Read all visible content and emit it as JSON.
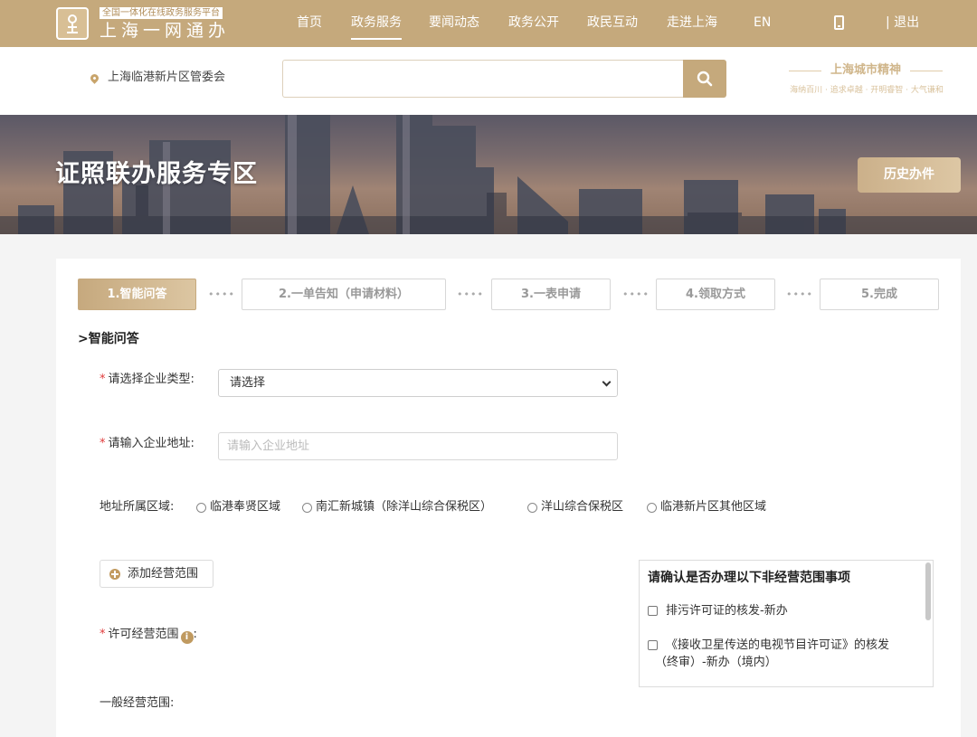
{
  "header": {
    "logo_icon": "city-emblem-icon",
    "logo_subtitle": "全国一体化在线政务服务平台",
    "logo_title": "上海一网通办",
    "nav": [
      "首页",
      "政务服务",
      "要闻动态",
      "政务公开",
      "政民互动",
      "走进上海",
      "EN"
    ],
    "active_nav": "政务服务",
    "phone_icon": "mobile-phone-icon",
    "logout": "| 退出"
  },
  "search_bar": {
    "location": "上海临港新片区管委会",
    "location_icon": "map-pin-icon",
    "query": "",
    "search_icon": "search-icon",
    "spirit_title": "上海城市精神",
    "spirit_subtitle": "海纳百川 · 追求卓越 · 开明睿智 · 大气谦和"
  },
  "banner": {
    "title": "证照联办服务专区",
    "history_button": "历史办件"
  },
  "steps": [
    "1.智能问答",
    "2.一单告知（申请材料）",
    "3.一表申请",
    "4.领取方式",
    "5.完成"
  ],
  "active_step": 0,
  "step_separator": "••••",
  "form": {
    "section_title": ">智能问答",
    "required_mark": "*",
    "company_type": {
      "label": "请选择企业类型:",
      "value": "请选择"
    },
    "company_address": {
      "label": "请输入企业地址:",
      "placeholder": "请输入企业地址",
      "value": ""
    },
    "region": {
      "label": "地址所属区域:",
      "options": [
        "临港奉贤区域",
        "南汇新城镇（除洋山综合保税区）",
        "洋山综合保税区",
        "临港新片区其他区域"
      ],
      "selected": null
    },
    "add_scope_button": "添加经营范围",
    "licensed_scope_label": "许可经营范围",
    "licensed_scope_suffix": ":",
    "info_icon": "info-icon",
    "general_scope_label": "一般经营范围:"
  },
  "confirm_panel": {
    "title": "请确认是否办理以下非经营范围事项",
    "items": [
      {
        "line1": "排污许可证的核发-新办",
        "line2": "",
        "checked": false
      },
      {
        "line1": "《接收卫星传送的电视节目许可证》的核发",
        "line2": "（终审）-新办（境内）",
        "checked": false
      }
    ]
  },
  "colors": {
    "gold_primary": "#c5a97c",
    "gold_light": "#dcc6a2",
    "required_red": "#e03b3b",
    "page_background": "#f4f4f4"
  }
}
